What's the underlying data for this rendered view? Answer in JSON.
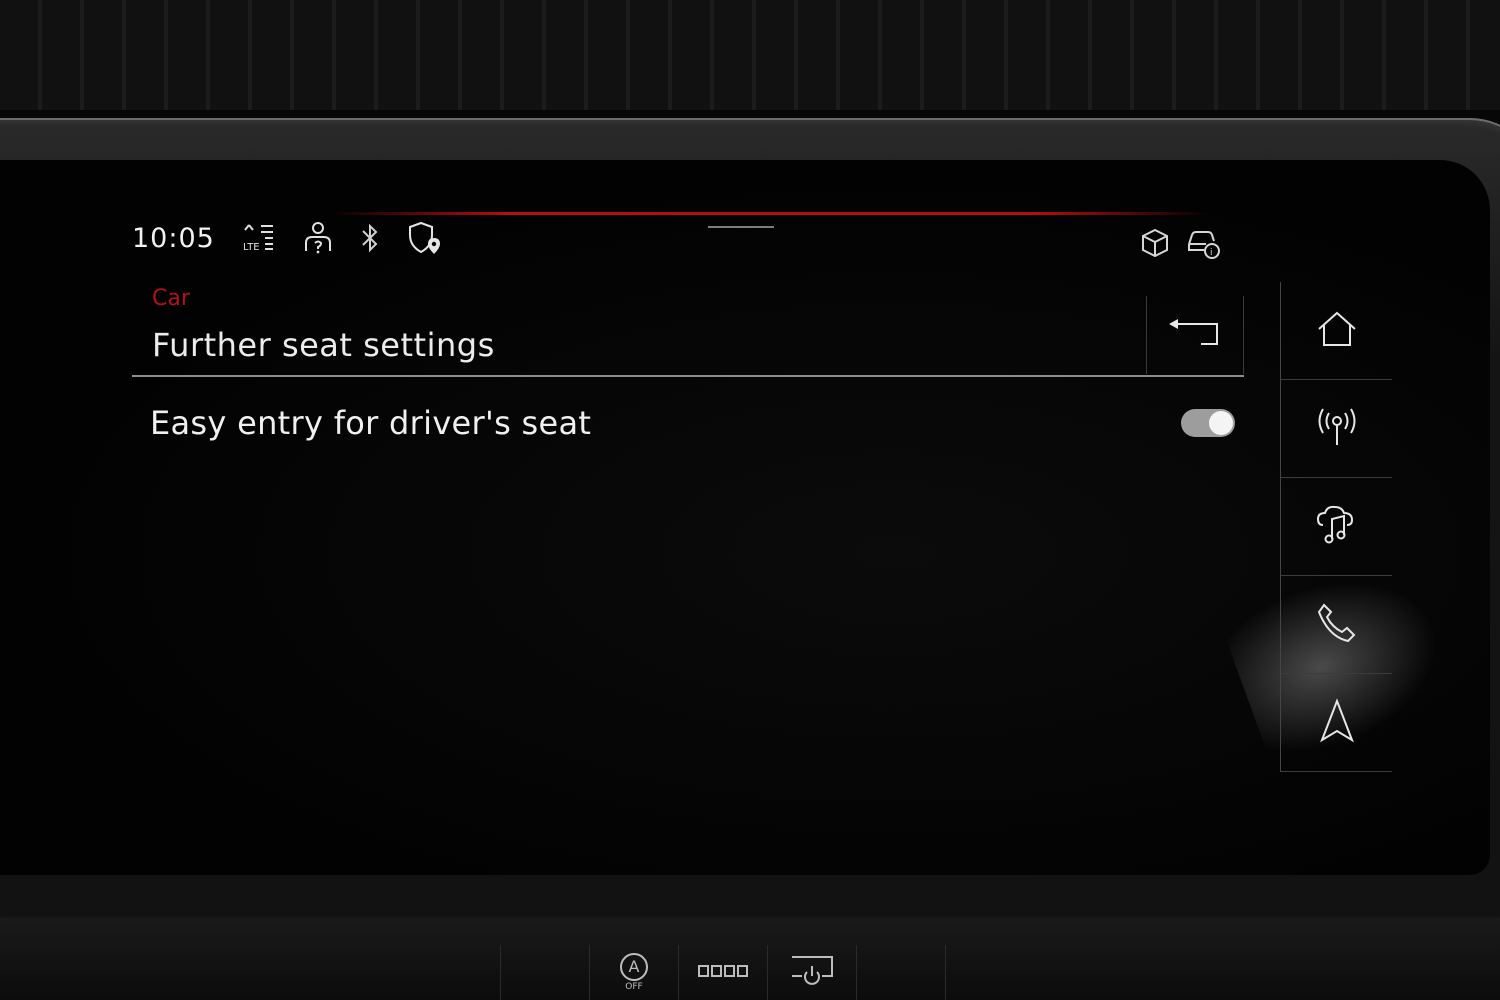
{
  "status_bar": {
    "time": "10:05",
    "icons": [
      "lte-signal-icon",
      "user-profile-icon",
      "bluetooth-icon",
      "location-shield-icon"
    ],
    "right_icons": [
      "package-box-icon",
      "car-info-icon"
    ]
  },
  "header": {
    "breadcrumb": "Car",
    "title": "Further seat settings",
    "back_icon": "back-arrow-icon"
  },
  "settings": [
    {
      "label": "Easy entry for driver's seat",
      "enabled": true
    }
  ],
  "nav_rail": [
    "home-icon",
    "radio-icon",
    "media-icon",
    "phone-icon",
    "navigation-icon"
  ],
  "lower_panel": {
    "auto_label": "A",
    "off_label": "OFF",
    "buttons": [
      "auto-start-stop-icon",
      "parking-sensor-icon",
      "power-icon"
    ]
  },
  "colors": {
    "accent_red": "#b3121a",
    "text": "#ececec",
    "background": "#020202"
  }
}
